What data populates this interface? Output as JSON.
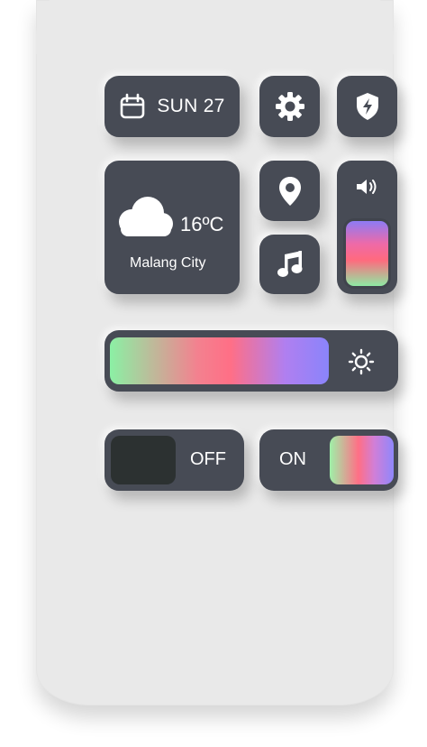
{
  "date_widget": {
    "text": "SUN 27",
    "icon": "calendar-icon"
  },
  "settings_widget": {
    "icon": "gear-icon"
  },
  "security_widget": {
    "icon": "shield-bolt-icon"
  },
  "weather_widget": {
    "temperature": "16ºC",
    "city": "Malang City",
    "icon": "cloud-icon"
  },
  "location_widget": {
    "icon": "location-pin-icon"
  },
  "music_widget": {
    "icon": "music-note-icon"
  },
  "volume_widget": {
    "icon": "speaker-icon",
    "level": 1.0
  },
  "brightness_widget": {
    "icon": "sun-icon",
    "level": 1.0
  },
  "toggle_off": {
    "label": "OFF",
    "state": "off"
  },
  "toggle_on": {
    "label": "ON",
    "state": "on"
  },
  "colors": {
    "tile": "#474b55",
    "background": "#e9e9e9",
    "gradient_green": "#8bf0a4",
    "gradient_pink": "#ff6f86",
    "gradient_purple": "#8a84fb"
  }
}
